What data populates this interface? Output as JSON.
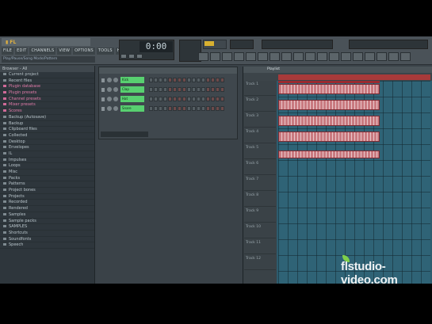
{
  "menu": [
    "FILE",
    "EDIT",
    "CHANNELS",
    "VIEW",
    "OPTIONS",
    "TOOLS",
    "HELP"
  ],
  "hint": "Play/Pause/Song Mode/Pattern",
  "time": "0:00",
  "browser": {
    "title": "Browser - All",
    "items": [
      {
        "label": "Current project",
        "pink": false
      },
      {
        "label": "Recent files",
        "pink": false
      },
      {
        "label": "Plugin database",
        "pink": true
      },
      {
        "label": "Plugin presets",
        "pink": true
      },
      {
        "label": "Channel presets",
        "pink": true
      },
      {
        "label": "Mixer presets",
        "pink": true
      },
      {
        "label": "Scores",
        "pink": true
      },
      {
        "label": "Backup (Autosave)",
        "pink": false
      },
      {
        "label": "Backup",
        "pink": false
      },
      {
        "label": "Clipboard files",
        "pink": false
      },
      {
        "label": "Collected",
        "pink": false
      },
      {
        "label": "Desktop",
        "pink": false
      },
      {
        "label": "Envelopes",
        "pink": false
      },
      {
        "label": "IL",
        "pink": false
      },
      {
        "label": "Impulses",
        "pink": false
      },
      {
        "label": "Loops",
        "pink": false
      },
      {
        "label": "Misc",
        "pink": false
      },
      {
        "label": "Packs",
        "pink": false
      },
      {
        "label": "Patterns",
        "pink": false
      },
      {
        "label": "Project bones",
        "pink": false
      },
      {
        "label": "Projects",
        "pink": false
      },
      {
        "label": "Recorded",
        "pink": false
      },
      {
        "label": "Rendered",
        "pink": false
      },
      {
        "label": "Samples",
        "pink": false
      },
      {
        "label": "Sample packs",
        "pink": false
      },
      {
        "label": "SAMPLES",
        "pink": false
      },
      {
        "label": "Shortcuts",
        "pink": false
      },
      {
        "label": "Soundfonts",
        "pink": false
      },
      {
        "label": "Speech",
        "pink": false
      }
    ]
  },
  "channels": [
    "Kick",
    "Clap",
    "Hat",
    "Snare"
  ],
  "playlist": {
    "title": "Playlist",
    "tracks": [
      "Track 1",
      "Track 2",
      "Track 3",
      "Track 4",
      "Track 5",
      "Track 6",
      "Track 7",
      "Track 8",
      "Track 9",
      "Track 10",
      "Track 11",
      "Track 12"
    ]
  },
  "watermark": "flstudio-video.com"
}
